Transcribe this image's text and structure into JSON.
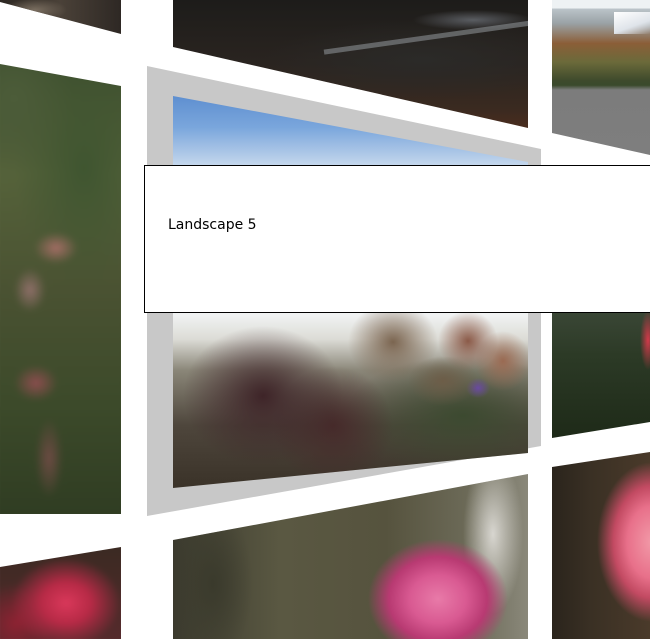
{
  "gallery": {
    "tiles": [
      {
        "id": "left-top",
        "icon": "landscape-photo"
      },
      {
        "id": "left-mid",
        "icon": "landscape-photo"
      },
      {
        "id": "left-bottom",
        "icon": "flower-photo"
      },
      {
        "id": "center-top",
        "icon": "landscape-photo"
      },
      {
        "id": "center-featured",
        "icon": "flower-photo"
      },
      {
        "id": "center-bottom",
        "icon": "flower-photo"
      },
      {
        "id": "right-top",
        "icon": "landscape-photo"
      },
      {
        "id": "right-mid",
        "icon": "landscape-photo"
      },
      {
        "id": "right-bottom",
        "icon": "flower-photo"
      }
    ],
    "selected_frame_color": "#c8c8c8"
  },
  "tooltip": {
    "title": "Landscape 5"
  }
}
